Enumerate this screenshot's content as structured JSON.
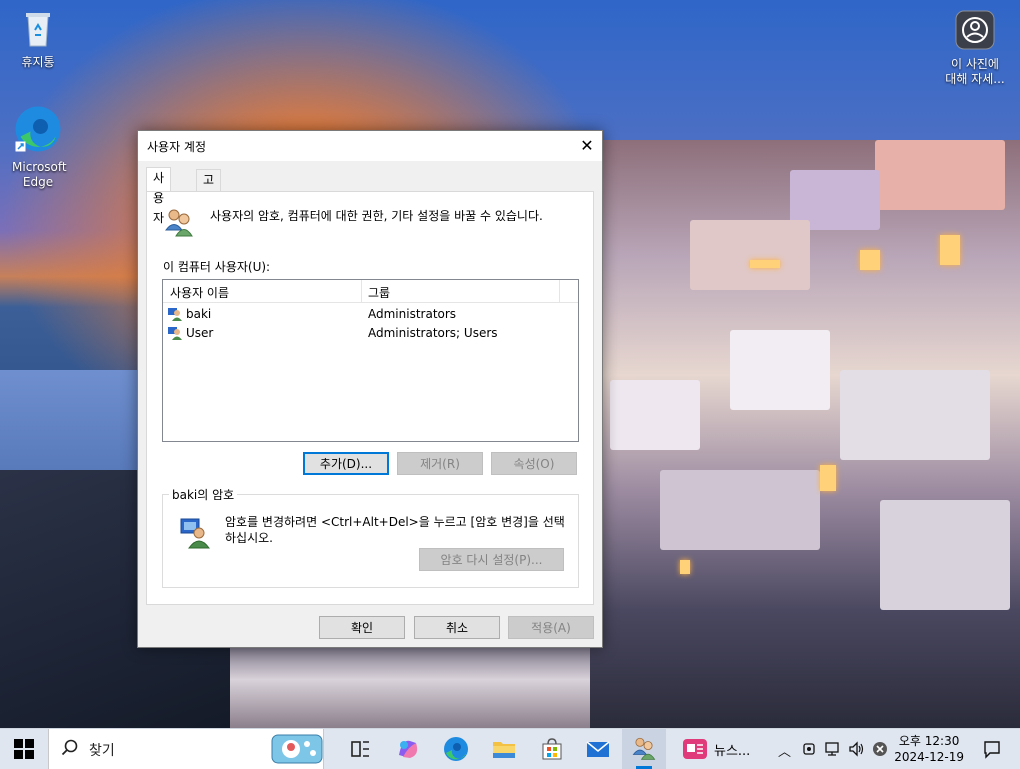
{
  "desktop": {
    "icons": [
      {
        "label": "휴지통",
        "icon": "recycle-bin-icon"
      },
      {
        "label": "Microsoft Edge",
        "icon": "edge-icon"
      }
    ],
    "learn_more": {
      "label": "이 사진에 대해 자세...",
      "icon": "learn-about-picture-icon"
    }
  },
  "dialog": {
    "title": "사용자 계정",
    "close_label": "✕",
    "tabs": [
      {
        "label": "사용자",
        "active": true
      },
      {
        "label": "고급",
        "active": false
      }
    ],
    "intro_text": "사용자의 암호, 컴퓨터에 대한 권한, 기타 설정을 바꿀 수 있습니다.",
    "users_label": "이 컴퓨터 사용자(U):",
    "columns": [
      "사용자 이름",
      "그룹"
    ],
    "users": [
      {
        "name": "baki",
        "group": "Administrators"
      },
      {
        "name": "User",
        "group": "Administrators; Users"
      }
    ],
    "buttons": {
      "add": "추가(D)...",
      "remove": "제거(R)",
      "properties": "속성(O)"
    },
    "password_group": {
      "title": "baki의 암호",
      "text": "암호를 변경하려면 <Ctrl+Alt+Del>을 누르고 [암호 변경]을 선택하십시오.",
      "reset_button": "암호 다시 설정(P)..."
    },
    "footer": {
      "ok": "확인",
      "cancel": "취소",
      "apply": "적용(A)"
    }
  },
  "taskbar": {
    "search_placeholder": "찾기",
    "apps": [
      {
        "name": "task-view",
        "icon": "task-view-icon"
      },
      {
        "name": "copilot",
        "icon": "copilot-icon"
      },
      {
        "name": "edge",
        "icon": "edge-icon"
      },
      {
        "name": "file-explorer",
        "icon": "folder-icon"
      },
      {
        "name": "store",
        "icon": "store-icon"
      },
      {
        "name": "mail",
        "icon": "mail-icon"
      },
      {
        "name": "user-accounts",
        "icon": "users-icon",
        "active": true
      },
      {
        "name": "news",
        "icon": "news-icon",
        "label": "뉴스..."
      }
    ],
    "clock": {
      "time": "오후 12:30",
      "date": "2024-12-19"
    },
    "accent": "#0078d7"
  }
}
